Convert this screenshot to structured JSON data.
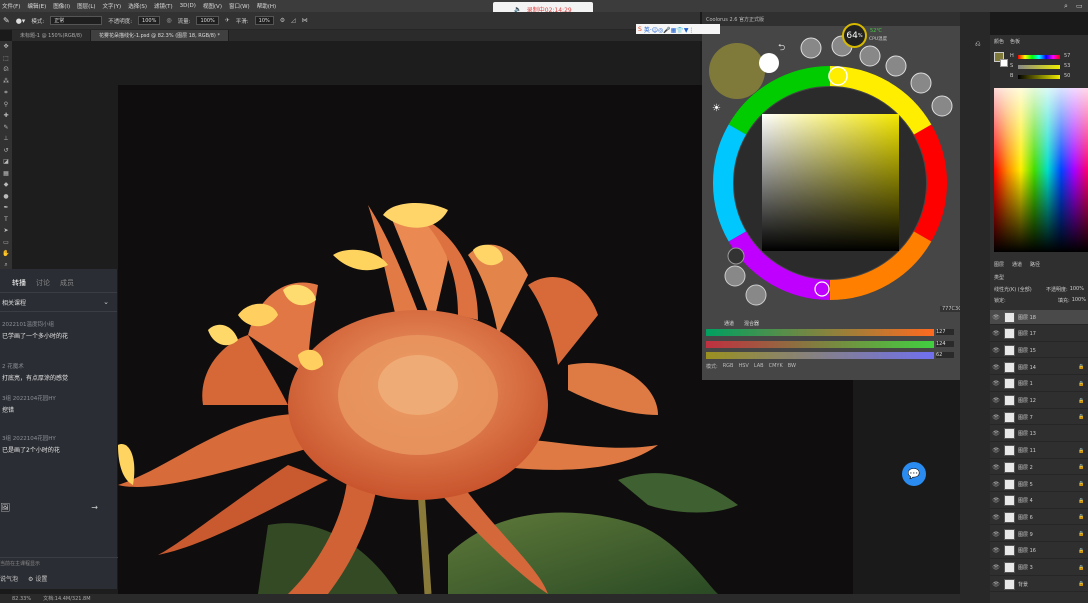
{
  "menu": [
    "文件(F)",
    "编辑(E)",
    "图像(I)",
    "图层(L)",
    "文字(Y)",
    "选择(S)",
    "滤镜(T)",
    "3D(D)",
    "视图(V)",
    "窗口(W)",
    "帮助(H)"
  ],
  "options": {
    "mode_label": "模式:",
    "mode_value": "正常",
    "opacity_label": "不透明度:",
    "opacity_value": "100%",
    "flow_label": "流量:",
    "flow_value": "100%",
    "smooth_label": "平滑:",
    "smooth_value": "10%"
  },
  "doc_tabs": [
    "未标题-1 @ 150%(RGB/8)",
    "花雾花朵描线化-1.psd @ 82.3% (图层 18, RGB/8) *"
  ],
  "recording": "录制中02:14:29",
  "color_panel": {
    "title": "Coolorus 2.6 官方正式版",
    "cpu_percent": "64",
    "cpu_unit": "%",
    "cpu_temp": "52℃",
    "cpu_label": "CPU温度",
    "hex": "777C3C",
    "tabs": [
      "通道",
      "混合器"
    ],
    "slider_values": [
      "127",
      "124",
      "62"
    ],
    "modes": [
      "模式:",
      "RGB",
      "HSV",
      "LAB",
      "CMYK",
      "BW"
    ],
    "fg_color": "#7f7a3a"
  },
  "right_top": {
    "tabs": [
      "颜色",
      "色板"
    ],
    "hsv_labels": [
      "H",
      "S",
      "B"
    ],
    "hsv_values": [
      "57",
      "53",
      "50"
    ]
  },
  "layers_panel": {
    "tabs": [
      "图层",
      "通道",
      "路径"
    ],
    "kind": "类型",
    "blend": "线性光(K) (全部)",
    "opacity_label": "不透明度:",
    "opacity_value": "100%",
    "lock_label": "锁定:",
    "fill_label": "填充:",
    "fill_value": "100%"
  },
  "layers": [
    {
      "name": "图层 18",
      "lock": ""
    },
    {
      "name": "图层 17",
      "lock": ""
    },
    {
      "name": "图层 15",
      "lock": ""
    },
    {
      "name": "图层 14",
      "lock": "🔒"
    },
    {
      "name": "图层 1",
      "lock": "🔒"
    },
    {
      "name": "图层 12",
      "lock": "🔒"
    },
    {
      "name": "图层 7",
      "lock": "🔒"
    },
    {
      "name": "图层 13",
      "lock": ""
    },
    {
      "name": "图层 11",
      "lock": "🔒"
    },
    {
      "name": "图层 2",
      "lock": "🔒"
    },
    {
      "name": "图层 5",
      "lock": "🔒"
    },
    {
      "name": "图层 4",
      "lock": "🔒"
    },
    {
      "name": "图层 6",
      "lock": "🔒"
    },
    {
      "name": "图层 9",
      "lock": "🔒"
    },
    {
      "name": "图层 16",
      "lock": "🔒"
    },
    {
      "name": "图层 3",
      "lock": "🔒"
    },
    {
      "name": "背景",
      "lock": "🔒"
    }
  ],
  "chat": {
    "tabs": [
      "转播",
      "讨论",
      "成员"
    ],
    "section": "相关课程",
    "messages": [
      {
        "who": "2022101温度钧小组",
        "text": "已学画了一个多小时的花"
      },
      {
        "who": "2  花魔术",
        "text": "打底亮，有点厚涂的感觉"
      },
      {
        "who": "3组 2022104花园HY",
        "text": "挖错"
      },
      {
        "who": "3组 2022104花园HY",
        "text": "已是画了2个小时的花"
      }
    ],
    "hint": "当前在主课程显示",
    "footer_left": "说气泡",
    "footer_right": "设置"
  },
  "status": {
    "zoom": "82.33%",
    "doc": "文档:14.4M/321.8M"
  }
}
